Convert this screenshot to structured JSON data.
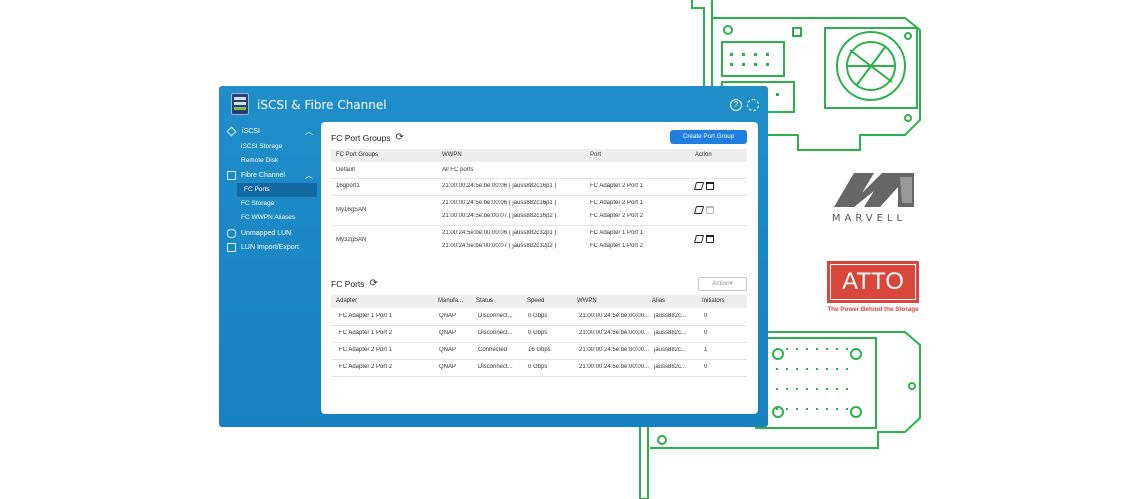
{
  "app": {
    "title": "iSCSI & Fibre Channel",
    "help_icon": "help-icon",
    "settings_icon": "gear-icon"
  },
  "sidebar": {
    "groups": [
      {
        "label": "iSCSI",
        "icon": "iscsi-icon",
        "items": [
          "iSCSI Storage",
          "Remote Disk"
        ]
      },
      {
        "label": "Fibre Channel",
        "icon": "fibre-channel-icon",
        "items": [
          "FC Ports",
          "FC Storage",
          "FC WWPN Aliases"
        ]
      },
      {
        "label": "Unmapped LUN",
        "icon": "lun-icon",
        "items": []
      },
      {
        "label": "LUN Import/Export",
        "icon": "lun-import-icon",
        "items": []
      }
    ],
    "active_item": "FC Ports"
  },
  "port_groups": {
    "title": "FC Port Groups",
    "create_label": "Create Port Group",
    "columns": [
      "FC Port Groups",
      "WWPN",
      "Port",
      "Action"
    ],
    "rows": [
      {
        "name": "Default",
        "wwpns": [
          "All FC ports"
        ],
        "ports": [
          ""
        ]
      },
      {
        "name": "16gport1",
        "wwpns": [
          "21:00:00:24:5e:be:00:06 ( jauss882c16p1 )"
        ],
        "ports": [
          "FC Adapter 2 Port 1"
        ]
      },
      {
        "name": "My16gSAN",
        "wwpns": [
          "21:00:00:24:5e:be:00:06 ( jauss882c16p1 )",
          "21:00:00:24:5e:be:00:07 ( jauss882c16p2 )"
        ],
        "ports": [
          "FC Adapter 2 Port 1",
          "FC Adapter 2 Port 2"
        ]
      },
      {
        "name": "My32gSAN",
        "wwpns": [
          "21:00:24:5e:be:00:00:06 ( jauss882c32p1 )",
          "21:00:24:5e:be:00:00:07 ( jauss882c32p2 )"
        ],
        "ports": [
          "FC Adapter 1 Port 1",
          "FC Adapter 1 Port 2"
        ]
      }
    ]
  },
  "fc_ports": {
    "title": "FC Ports",
    "action_label": "Action▾",
    "columns": [
      "Adapter",
      "Manufa...",
      "Status",
      "Speed",
      "WWPN",
      "Alias",
      "Initiators"
    ],
    "rows": [
      [
        "FC Adapter 1 Port 1",
        "QNAP",
        "Disconnect...",
        "0 Gbps",
        "21:00:00:24:5e:be:00:00...",
        "jauss882c...",
        "0"
      ],
      [
        "FC Adapter 1 Port 2",
        "QNAP",
        "Disconnect...",
        "0 Gbps",
        "21:00:00:24:5e:be:00:00...",
        "jauss882c...",
        "0"
      ],
      [
        "FC Adapter 2 Port 1",
        "QNAP",
        "Connected",
        "16 Gbps",
        "21:00:00:24:5e:be:00:00...",
        "jauss882c...",
        "1"
      ],
      [
        "FC Adapter 2 Port 2",
        "QNAP",
        "Disconnect...",
        "0 Gbps",
        "21:00:00:24:5e:be:00:00...",
        "jauss882c...",
        "0"
      ]
    ]
  },
  "logos": {
    "marvell": "MARVELL",
    "atto": "ATTO",
    "atto_tagline": "The Power Behind the Storage"
  },
  "colors": {
    "accent": "#1e7fe0",
    "app_bg": "#1581bf",
    "hardware_line": "#2bb24c",
    "atto_red": "#d8463c"
  }
}
